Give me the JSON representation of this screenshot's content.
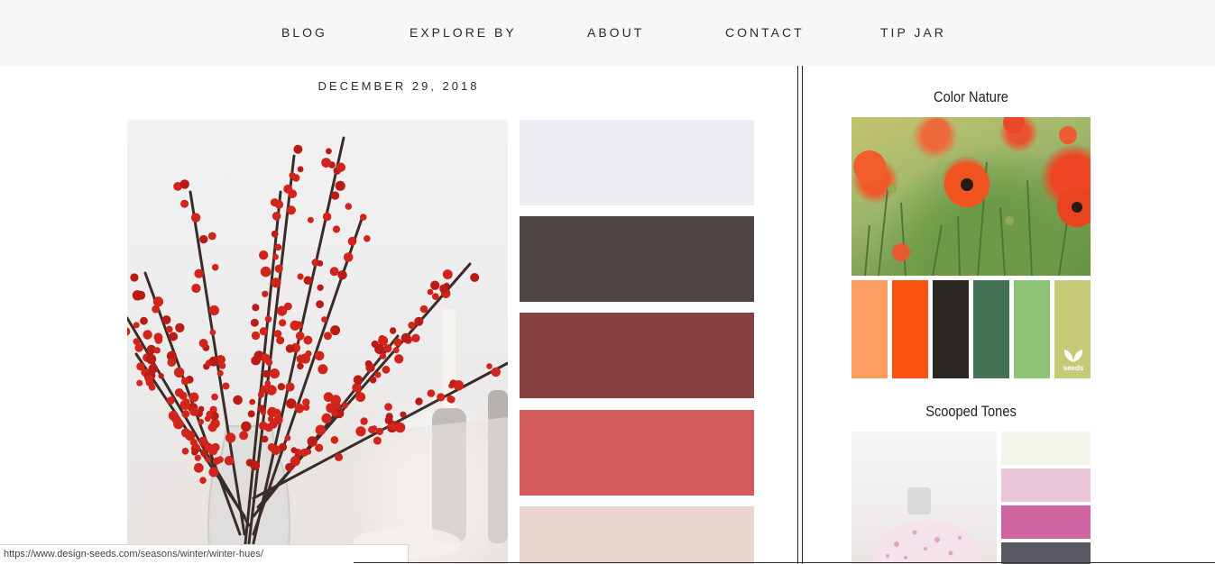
{
  "nav": {
    "items": [
      {
        "label": "BLOG"
      },
      {
        "label": "EXPLORE BY"
      },
      {
        "label": "ABOUT"
      },
      {
        "label": "CONTACT"
      },
      {
        "label": "TIP JAR"
      }
    ]
  },
  "post": {
    "date": "DECEMBER 29, 2018",
    "palette": [
      "#edeef1",
      "#4f4644",
      "#874141",
      "#d35b5b",
      "#ead6ce"
    ]
  },
  "sidebar": {
    "card1": {
      "title": "Color Nature",
      "palette": [
        "#fc9d62",
        "#fa520f",
        "#2b2824",
        "#457356",
        "#8ec477",
        "#c4ca76"
      ],
      "logo": "seeds"
    },
    "card2": {
      "title": "Scooped Tones",
      "palette": [
        "#f5f4ea",
        "#ebc8d9",
        "#ce65a1",
        "#5a5760"
      ]
    }
  },
  "status": {
    "url": "https://www.design-seeds.com/seasons/winter/winter-hues/"
  }
}
